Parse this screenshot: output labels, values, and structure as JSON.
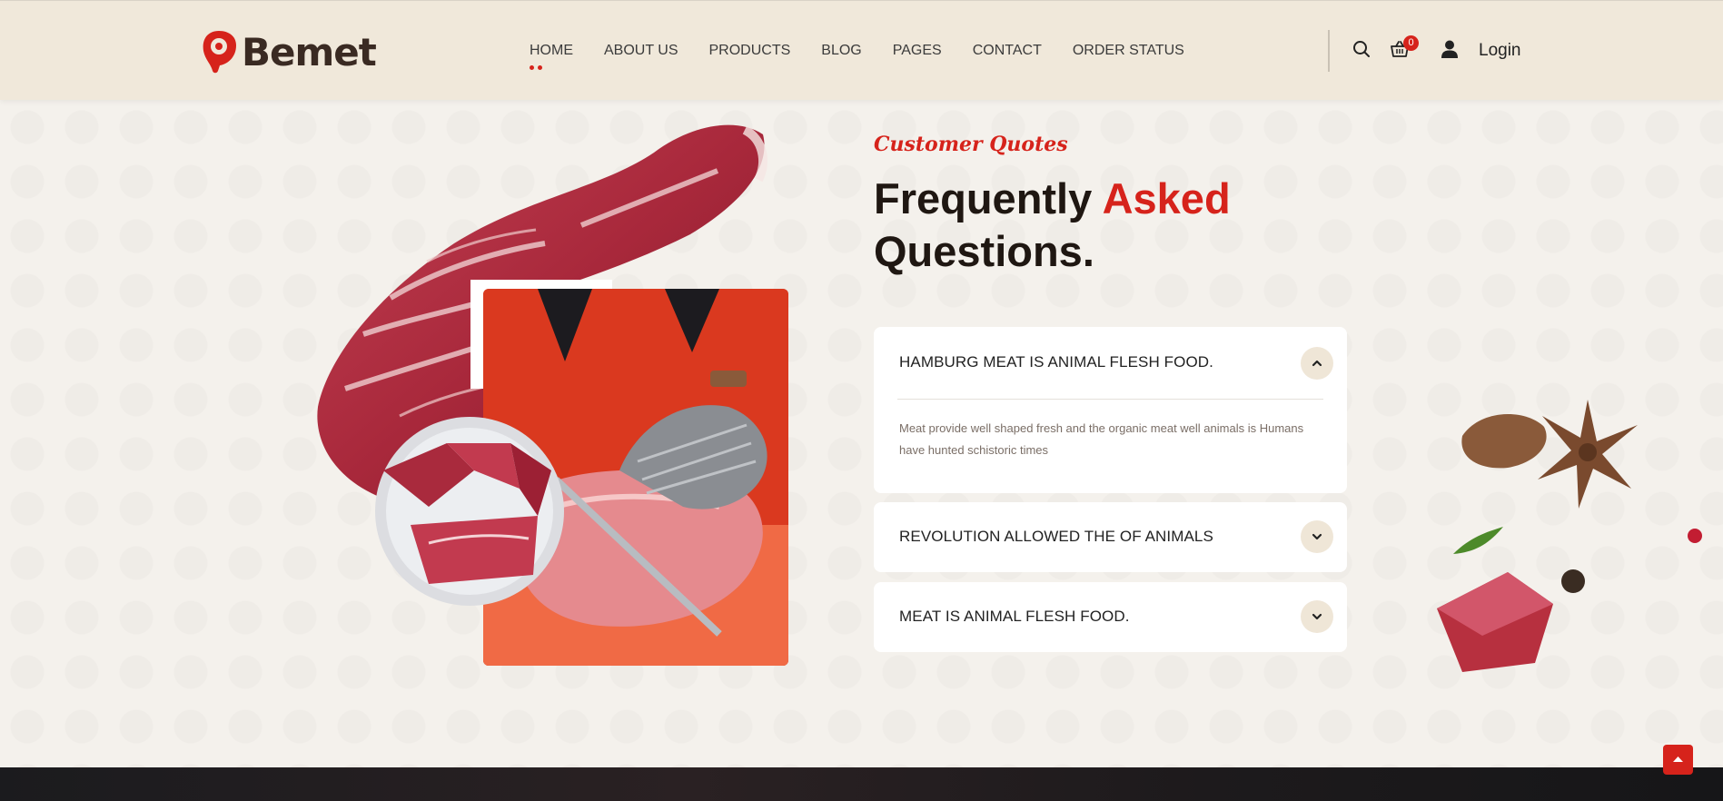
{
  "brand": {
    "name": "Bemet"
  },
  "nav": {
    "items": [
      "HOME",
      "ABOUT US",
      "PRODUCTS",
      "BLOG",
      "PAGES",
      "CONTACT",
      "ORDER STATUS"
    ],
    "active": "HOME"
  },
  "header": {
    "cart_count": "0",
    "login_label": "Login",
    "icons": [
      "search-icon",
      "basket-icon",
      "user-icon"
    ]
  },
  "faq_section": {
    "kicker": "Customer Quotes",
    "title_part1": "Frequently ",
    "title_accent": "Asked",
    "title_part2": "Questions.",
    "items": [
      {
        "question": "HAMBURG MEAT IS ANIMAL FLESH FOOD.",
        "answer": "Meat provide well shaped fresh and the organic meat well animals is Humans have hunted schistoric times",
        "expanded": true
      },
      {
        "question": "REVOLUTION ALLOWED THE OF ANIMALS",
        "expanded": false
      },
      {
        "question": "MEAT IS ANIMAL FLESH FOOD.",
        "expanded": false
      }
    ]
  },
  "colors": {
    "accent": "#d6231b",
    "header_bg": "#f0e8da",
    "page_bg": "#f4f1ec",
    "toggle_bg": "#efe6d7"
  }
}
